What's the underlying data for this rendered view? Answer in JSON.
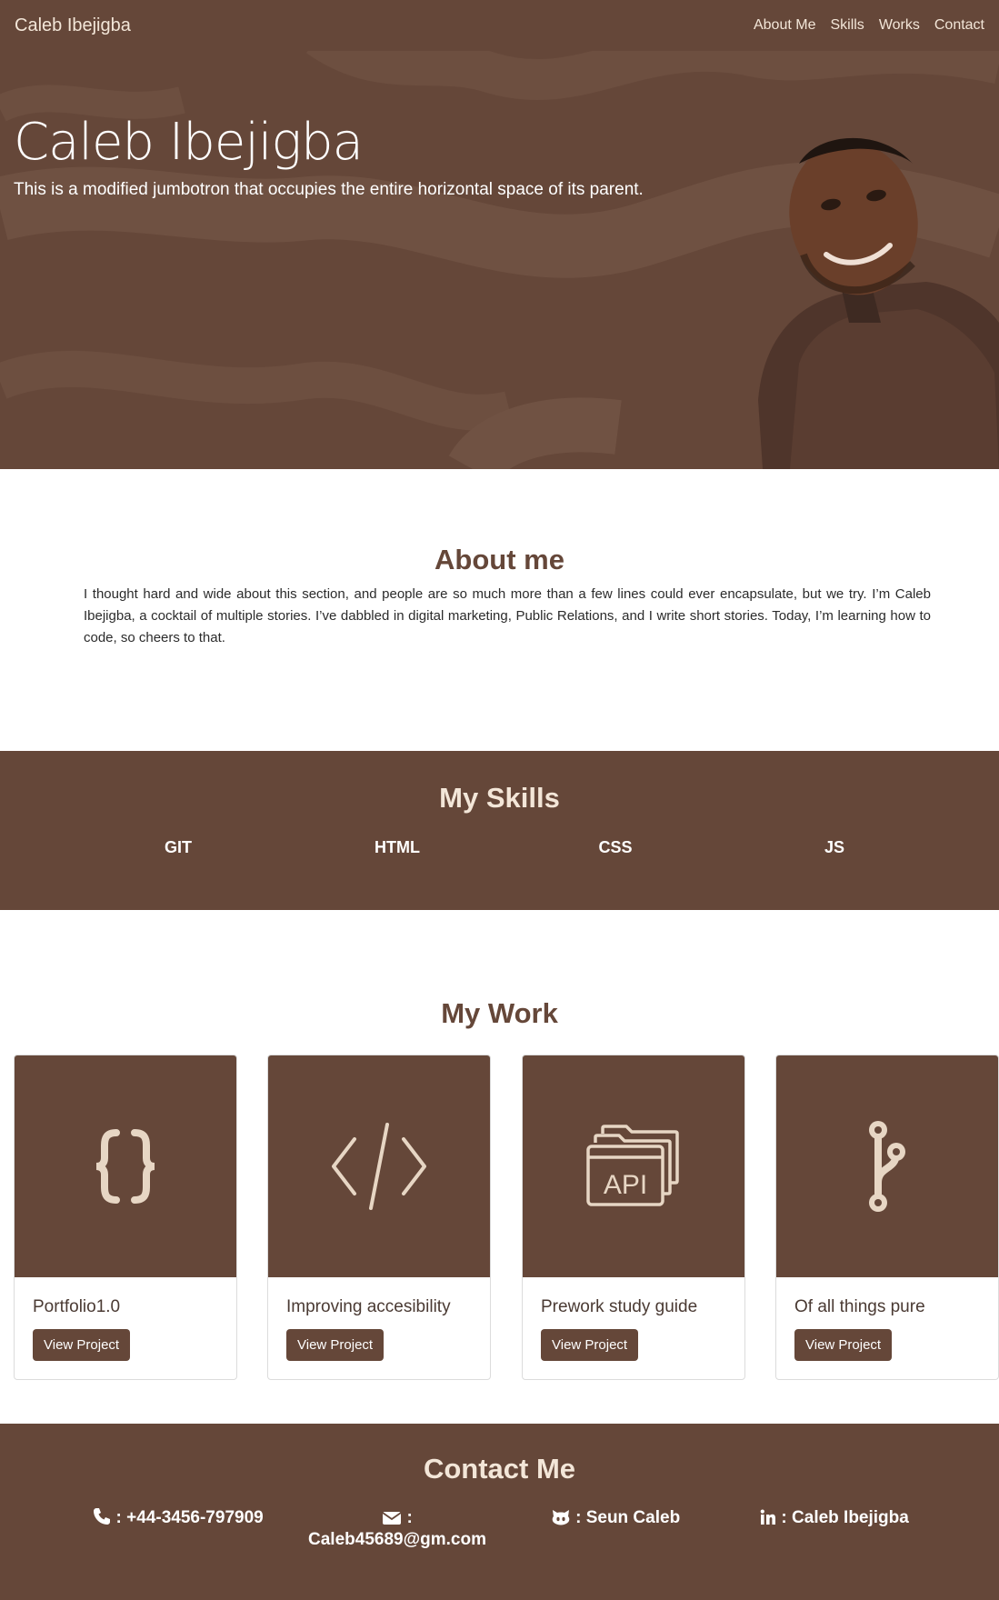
{
  "nav": {
    "brand": "Caleb Ibejigba",
    "links": [
      "About Me",
      "Skills",
      "Works",
      "Contact"
    ]
  },
  "hero": {
    "title": "Caleb Ibejigba",
    "subtitle": "This is a modified jumbotron that occupies the entire horizontal space of its parent."
  },
  "about": {
    "heading": "About me",
    "text": "I thought hard and wide about this section, and people are so much more than a few lines could ever encapsulate, but we try. I’m Caleb Ibejigba, a cocktail of multiple stories. I’ve dabbled in digital marketing, Public Relations, and I write short stories. Today, I’m learning how to code, so cheers to that."
  },
  "skills": {
    "heading": "My Skills",
    "items": [
      "GIT",
      "HTML",
      "CSS",
      "JS"
    ]
  },
  "work": {
    "heading": "My Work",
    "cards": [
      {
        "title": "Portfolio1.0",
        "button": "View Project",
        "icon": "curly-braces-icon"
      },
      {
        "title": "Improving accesibility",
        "button": "View Project",
        "icon": "code-icon"
      },
      {
        "title": "Prework study guide",
        "button": "View Project",
        "icon": "api-icon"
      },
      {
        "title": "Of all things pure",
        "button": "View Project",
        "icon": "git-branch-icon"
      }
    ],
    "icon_text": "API"
  },
  "contact": {
    "heading": "Contact Me",
    "phone": ": +44-3456-797909",
    "email_sep": ":",
    "email": "Caleb45689@gm.com",
    "github": ": Seun Caleb",
    "linkedin": ": Caleb Ibejigba"
  },
  "colors": {
    "brand": "#654739",
    "accent_text": "#f3e6d8"
  }
}
